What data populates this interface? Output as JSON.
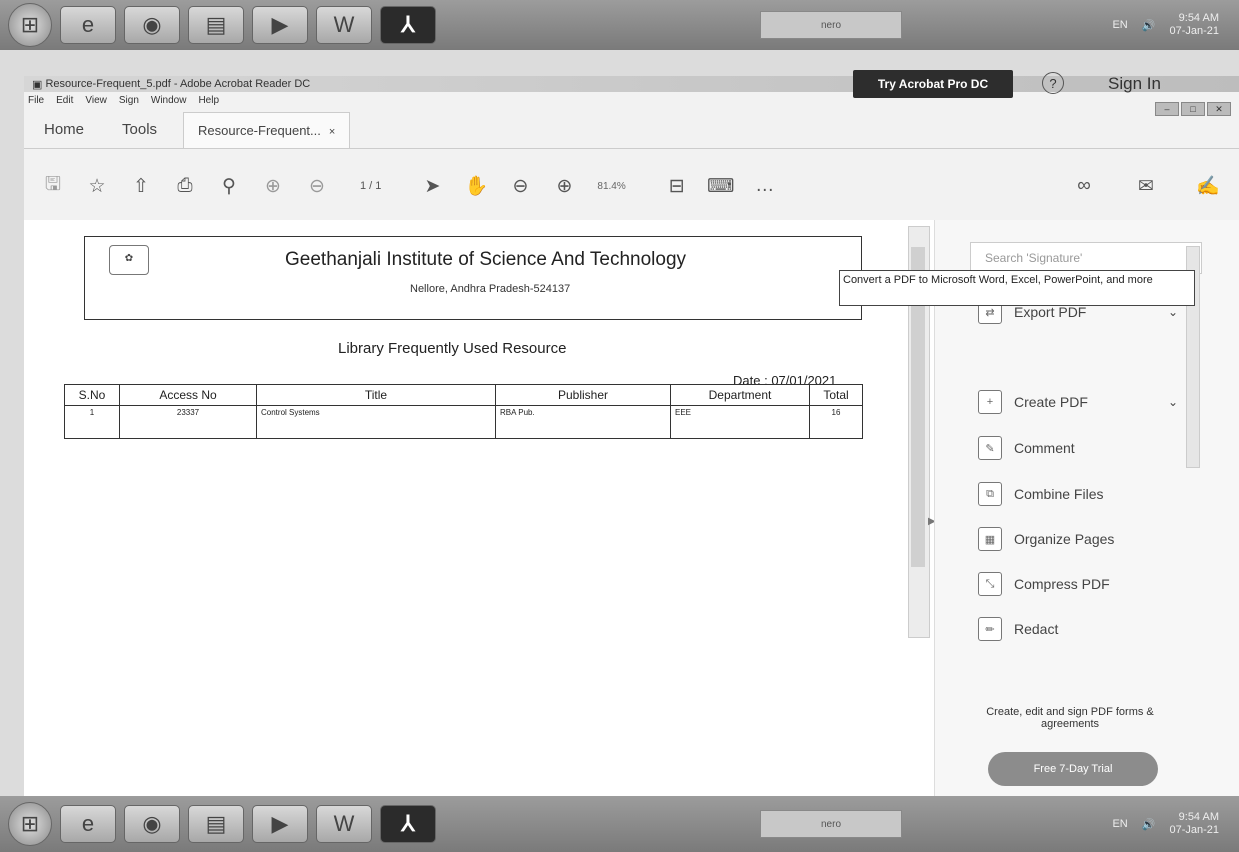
{
  "window": {
    "title": "Resource-Frequent_5.pdf - Adobe Acrobat Reader DC",
    "menu": [
      "File",
      "Edit",
      "View",
      "Sign",
      "Window",
      "Help"
    ]
  },
  "tabs": {
    "home": "Home",
    "tools": "Tools",
    "document": "Resource-Frequent...",
    "close": "×"
  },
  "header_right": {
    "try_button": "Try Acrobat Pro DC",
    "help": "?",
    "sign_in": "Sign In"
  },
  "toolbar": {
    "page": "1 / 1",
    "zoom": "81.4%"
  },
  "document": {
    "logo_text": "✿",
    "institution": "Geethanjali Institute of Science And Technology",
    "address": "Nellore, Andhra Pradesh-524137",
    "report_title": "Library Frequently Used Resource",
    "date_label": "Date :",
    "date_value": "07/01/2021",
    "columns": [
      "S.No",
      "Access No",
      "Title",
      "Publisher",
      "Department",
      "Total"
    ],
    "rows": [
      [
        "1",
        "23337",
        "Control Systems",
        "RBA Pub.",
        "EEE",
        "16"
      ]
    ]
  },
  "right_panel": {
    "search_placeholder": "Search 'Signature'",
    "items": [
      "Export PDF",
      "Create PDF",
      "Comment",
      "Combine Files",
      "Organize Pages",
      "Compress PDF",
      "Redact"
    ],
    "tooltip": "Convert a PDF to Microsoft Word, Excel, PowerPoint, and more",
    "promo": "Create, edit and sign PDF forms & agreements",
    "trial_button": "Free 7-Day Trial"
  },
  "taskbar": {
    "nero": "nero",
    "lang": "EN",
    "time": "9:54 AM",
    "date": "07-Jan-21"
  }
}
